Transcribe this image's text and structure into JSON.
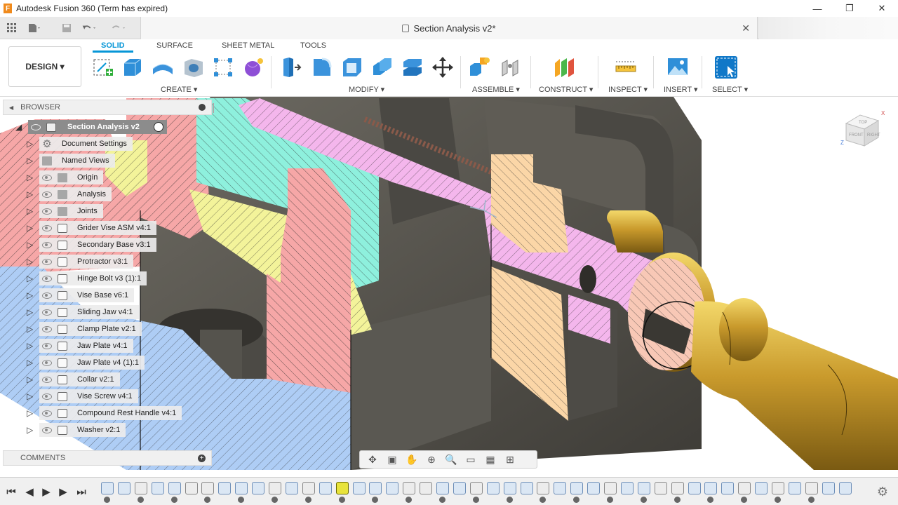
{
  "window": {
    "title": "Autodesk Fusion 360 (Term has expired)",
    "logo_letter": "F",
    "minimize": "—",
    "maximize": "❐",
    "close": "✕"
  },
  "document": {
    "tab_title": "Section Analysis v2*",
    "close": "✕"
  },
  "ribbon": {
    "workspace": "DESIGN ▾",
    "tabs": [
      "SOLID",
      "SURFACE",
      "SHEET METAL",
      "TOOLS"
    ],
    "groups": [
      "CREATE ▾",
      "MODIFY ▾",
      "ASSEMBLE ▾",
      "CONSTRUCT ▾",
      "INSPECT ▾",
      "INSERT ▾",
      "SELECT ▾"
    ]
  },
  "browser": {
    "title": "BROWSER",
    "root": "Section Analysis v2",
    "items": [
      {
        "label": "Document Settings",
        "icon": "gear-icon"
      },
      {
        "label": "Named Views",
        "icon": "folder-icon"
      },
      {
        "label": "Origin",
        "icon": "folder-icon"
      },
      {
        "label": "Analysis",
        "icon": "folder-icon"
      },
      {
        "label": "Joints",
        "icon": "folder-icon"
      },
      {
        "label": "Grider Vise ASM v4:1",
        "icon": "component-icon"
      },
      {
        "label": "Secondary Base v3:1",
        "icon": "component-icon"
      },
      {
        "label": "Protractor v3:1",
        "icon": "component-icon"
      },
      {
        "label": "Hinge Bolt v3 (1):1",
        "icon": "component-icon"
      },
      {
        "label": "Vise Base v6:1",
        "icon": "component-icon"
      },
      {
        "label": "Sliding Jaw v4:1",
        "icon": "component-icon"
      },
      {
        "label": "Clamp Plate v2:1",
        "icon": "component-icon"
      },
      {
        "label": "Jaw Plate v4:1",
        "icon": "component-icon"
      },
      {
        "label": "Jaw Plate v4 (1):1",
        "icon": "component-icon"
      },
      {
        "label": "Collar v2:1",
        "icon": "component-icon"
      },
      {
        "label": "Vise Screw v4:1",
        "icon": "component-icon"
      },
      {
        "label": "Compound Rest Handle v4:1",
        "icon": "component-icon"
      },
      {
        "label": "Washer v2:1",
        "icon": "component-icon"
      }
    ]
  },
  "comments": {
    "title": "COMMENTS"
  },
  "viewcube": {
    "top": "TOP",
    "front": "FRONT",
    "right": "RIGHT",
    "axis_z": "Z",
    "axis_x": "X"
  },
  "navbar": [
    "orbit-icon",
    "look-at-icon",
    "pan-icon",
    "zoom-icon",
    "fit-icon",
    "display-icon",
    "grid-icon",
    "viewports-icon"
  ],
  "timeline": {
    "controls": [
      "⏮",
      "◀",
      "▶",
      "▶",
      "⏭"
    ],
    "settings": "⚙"
  }
}
